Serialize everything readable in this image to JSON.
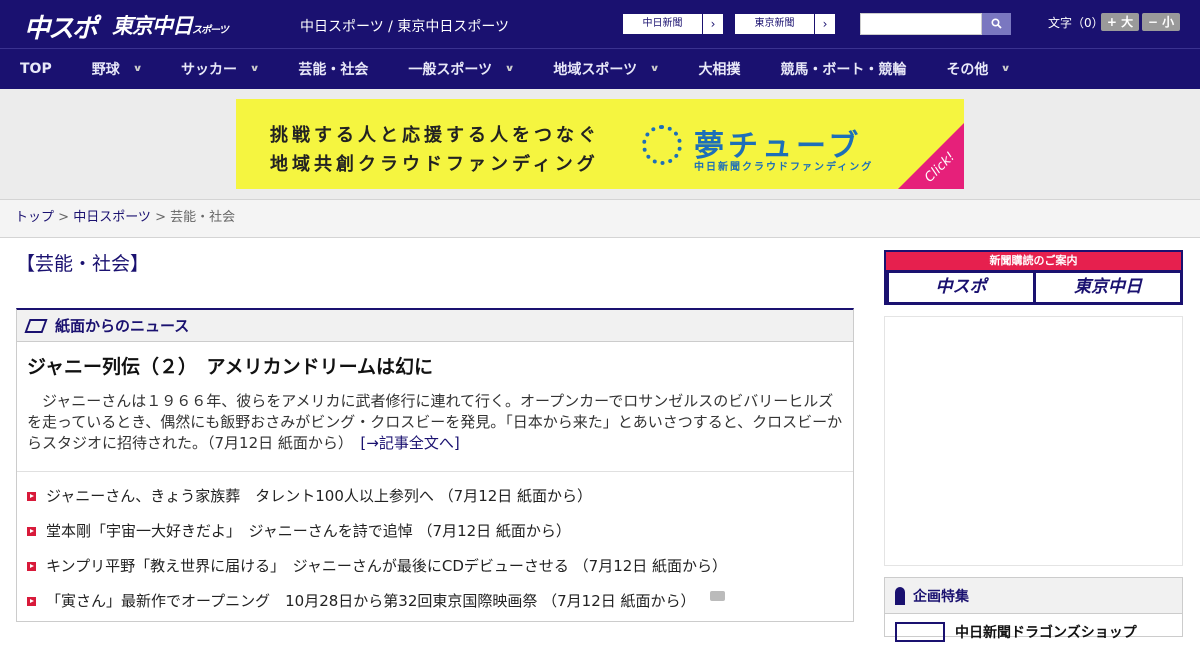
{
  "header": {
    "logo_chuspo": "中スポ",
    "logo_tokyo": "東京中日",
    "logo_tokyo_small": "スポーツ",
    "site_title": "中日スポーツ / 東京中日スポーツ",
    "paper_links": [
      {
        "label": "中日新聞",
        "arrow": "›"
      },
      {
        "label": "東京新聞",
        "arrow": "›"
      }
    ],
    "search_placeholder": "",
    "search_icon": "search-icon",
    "font_size_label": "文字（0）",
    "font_larger": "+ 大",
    "font_smaller": "− 小"
  },
  "nav": {
    "items": [
      {
        "label": "TOP",
        "has_dropdown": false
      },
      {
        "label": "野球",
        "has_dropdown": true
      },
      {
        "label": "サッカー",
        "has_dropdown": true
      },
      {
        "label": "芸能・社会",
        "has_dropdown": false
      },
      {
        "label": "一般スポーツ",
        "has_dropdown": true
      },
      {
        "label": "地域スポーツ",
        "has_dropdown": true
      },
      {
        "label": "大相撲",
        "has_dropdown": false
      },
      {
        "label": "競馬・ボート・競輪",
        "has_dropdown": false
      },
      {
        "label": "その他",
        "has_dropdown": true
      }
    ],
    "chevron": "∨"
  },
  "banner": {
    "line1": "挑戦する人と応援する人をつなぐ",
    "line2": "地域共創クラウドファンディング",
    "brand": "夢チューブ",
    "brand_sub": "中日新聞クラウドファンディング",
    "click": "Click!"
  },
  "breadcrumb": {
    "top": "トップ",
    "sep": " > ",
    "parent": "中日スポーツ",
    "current": "芸能・社会"
  },
  "main": {
    "category_title": "【芸能・社会】",
    "news_header": "紙面からのニュース",
    "lead_title": "ジャニー列伝（２）　アメリカンドリームは幻に",
    "lead_body": "　ジャニーさんは１９６６年、彼らをアメリカに武者修行に連れて行く。オープンカーでロサンゼルスのビバリーヒルズを走っているとき、偶然にも飯野おさみがビング・クロスビーを発見。「日本から来た」とあいさつすると、クロスビーからスタジオに招待された。（7月12日 紙面から）　",
    "lead_more": "[→記事全文へ]",
    "news_items": [
      {
        "text": "ジャニーさん、きょう家族葬　タレント100人以上参列へ （7月12日 紙面から）",
        "photo": false
      },
      {
        "text": "堂本剛「宇宙一大好きだよ」　ジャニーさんを詩で追悼 （7月12日 紙面から）",
        "photo": false
      },
      {
        "text": "キンプリ平野「教え世界に届ける」　ジャニーさんが最後にCDデビューさせる （7月12日 紙面から）",
        "photo": false
      },
      {
        "text": "「寅さん」最新作でオープニング　10月28日から第32回東京国際映画祭 （7月12日 紙面から）",
        "photo": true
      }
    ]
  },
  "sidebar": {
    "subscribe_title": "新聞購読のご案内",
    "subscribe_chuspo": "中スポ",
    "subscribe_tokyo": "東京中日",
    "feature_title": "企画特集",
    "feature_item": "中日新聞ドラゴンズショップ"
  },
  "colors": {
    "brand_navy": "#1a1170",
    "accent_red": "#d81a3a",
    "banner_yellow": "#f5f540",
    "banner_blue": "#1d6fb8",
    "banner_pink": "#e6207a"
  }
}
